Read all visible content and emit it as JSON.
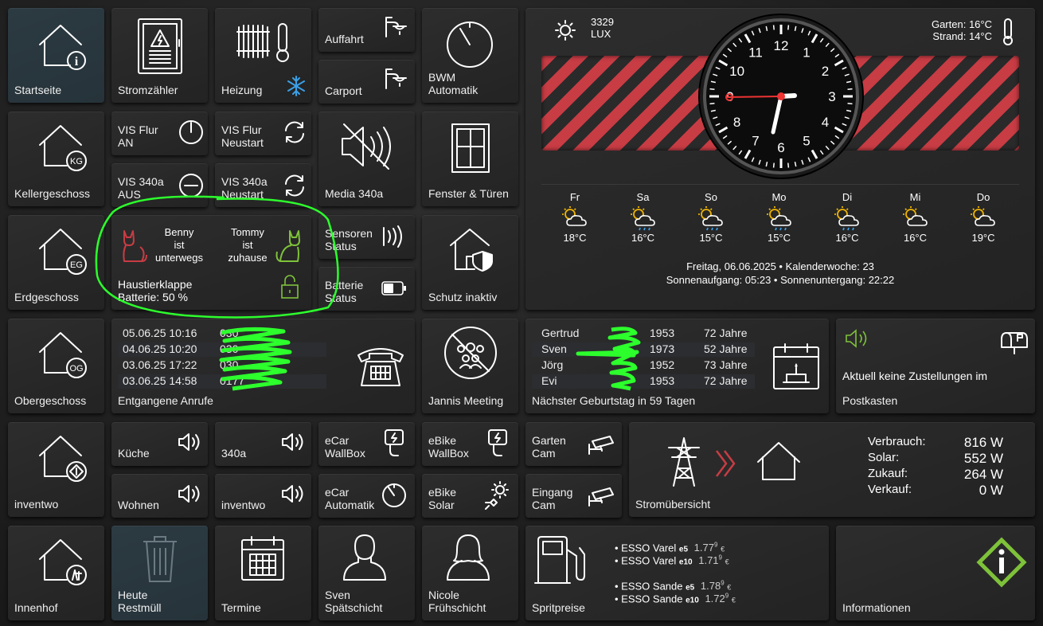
{
  "home": {
    "label": "Startseite"
  },
  "nav": {
    "keller": "Kellergeschoss",
    "keller_badge": "KG",
    "erd": "Erdgeschoss",
    "erd_badge": "EG",
    "ober": "Obergeschoss",
    "ober_badge": "OG",
    "inventwo": "inventwo",
    "innenhof": "Innenhof"
  },
  "row1": {
    "strom": "Stromzähler",
    "heizung": "Heizung",
    "auffahrt": "Auffahrt",
    "carport": "Carport",
    "bwm": "BWM\nAutomatik"
  },
  "vis": {
    "flur_an": "VIS Flur\nAN",
    "flur_neustart": "VIS Flur\nNeustart",
    "v340a_aus": "VIS 340a\nAUS",
    "v340a_neustart": "VIS 340a\nNeustart"
  },
  "media": "Media 340a",
  "fenster": "Fenster & Türen",
  "sensoren": "Sensoren\nStatus",
  "batterie": "Batterie\nStatus",
  "schutz": "Schutz inaktiv",
  "haustier": {
    "benny": "Benny\nist\nunterwegs",
    "tommy": "Tommy\nist\nzuhause",
    "title": "Haustierklappe",
    "battery": "Batterie: 50 %"
  },
  "weather": {
    "lux_value": "3329",
    "lux_unit": "LUX",
    "garten": "Garten:",
    "garten_temp": "16°C",
    "strand": "Strand:",
    "strand_temp": "14°C",
    "forecast": [
      {
        "day": "Fr",
        "temp": "18°C"
      },
      {
        "day": "Sa",
        "temp": "16°C"
      },
      {
        "day": "So",
        "temp": "15°C"
      },
      {
        "day": "Mo",
        "temp": "15°C"
      },
      {
        "day": "Di",
        "temp": "16°C"
      },
      {
        "day": "Mi",
        "temp": "16°C"
      },
      {
        "day": "Do",
        "temp": "19°C"
      }
    ],
    "date_line": "Freitag, 06.06.2025 • Kalenderwoche: 23",
    "sun_line": "Sonnenaufgang: 05:23 • Sonnenuntergang: 22:22",
    "clock_numbers": [
      "12",
      "1",
      "2",
      "3",
      "4",
      "5",
      "6",
      "7",
      "8",
      "9",
      "10",
      "11"
    ]
  },
  "calls": {
    "title": "Entgangene Anrufe",
    "rows": [
      {
        "time": "05.06.25 10:16",
        "num": "030"
      },
      {
        "time": "04.06.25 10:20",
        "num": "030"
      },
      {
        "time": "03.06.25 17:22",
        "num": "030"
      },
      {
        "time": "03.06.25 14:58",
        "num": "0177"
      }
    ]
  },
  "meeting": "Jannis Meeting",
  "birthdays": {
    "title": "Nächster Geburtstag in 59 Tagen",
    "rows": [
      {
        "name": "Gertrud",
        "year": "1953",
        "age": "72 Jahre"
      },
      {
        "name": "Sven",
        "year": "1973",
        "age": "52 Jahre"
      },
      {
        "name": "Jörg",
        "year": "1952",
        "age": "73 Jahre"
      },
      {
        "name": "Evi",
        "year": "1953",
        "age": "72 Jahre"
      }
    ]
  },
  "post": {
    "msg1": "Aktuell keine Zustellungen im",
    "msg2": "Postkasten"
  },
  "audio": {
    "kueche": "Küche",
    "a340": "340a",
    "wohnen": "Wohnen",
    "inventwo": "inventwo"
  },
  "ecar": {
    "wallbox": "eCar\nWallBox",
    "auto": "eCar\nAutomatik"
  },
  "ebike": {
    "wallbox": "eBike\nWallBox",
    "solar": "eBike\nSolar"
  },
  "cams": {
    "garten": "Garten\nCam",
    "eingang": "Eingang\nCam"
  },
  "strom": {
    "title": "Stromübersicht",
    "rows": [
      {
        "label": "Verbrauch:",
        "value": "816 W"
      },
      {
        "label": "Solar:",
        "value": "552 W"
      },
      {
        "label": "Zukauf:",
        "value": "264 W"
      },
      {
        "label": "Verkauf:",
        "value": "0 W"
      }
    ]
  },
  "bottom": {
    "restmuell": "Heute\nRestmüll",
    "termine": "Termine",
    "sven": "Sven\nSpätschicht",
    "nicole": "Nicole\nFrühschicht",
    "sprit": "Spritpreise",
    "info": "Informationen"
  },
  "fuel": [
    {
      "name": "• ESSO Varel",
      "type": "e5",
      "price": "1.77",
      "sup": "9",
      "unit": "€"
    },
    {
      "name": "• ESSO Varel",
      "type": "e10",
      "price": "1.71",
      "sup": "9",
      "unit": "€"
    },
    {
      "name": "• ESSO Sande",
      "type": "e5",
      "price": "1.78",
      "sup": "9",
      "unit": "€"
    },
    {
      "name": "• ESSO Sande",
      "type": "e10",
      "price": "1.72",
      "sup": "9",
      "unit": "€"
    }
  ],
  "colors": {
    "accent_green": "#7ec23a",
    "alarm_red": "#c83c44",
    "scribble": "#2dff2d"
  }
}
